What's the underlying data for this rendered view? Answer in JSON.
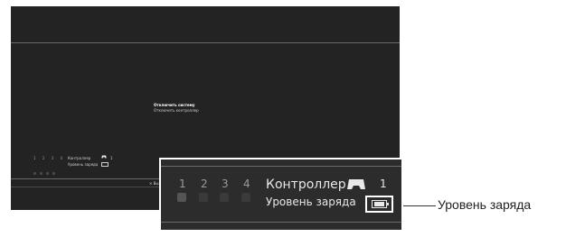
{
  "system_menu": {
    "items": [
      {
        "label": "Отключить систему",
        "selected": true
      },
      {
        "label": "Отключить контроллер",
        "selected": false
      }
    ]
  },
  "status_bar": {
    "ports": [
      "1",
      "2",
      "3",
      "4"
    ],
    "active_port": 1,
    "controller_label": "Контроллер",
    "controller_number": "1",
    "battery_label": "Уровень заряда",
    "controller_icon": "gamepad-icon",
    "battery_icon": "battery-icon",
    "battery_level": 1.0
  },
  "hint": {
    "icon": "cross-button-icon",
    "text": "✕ Вы"
  },
  "callout": {
    "label": "Уровень заряда"
  }
}
